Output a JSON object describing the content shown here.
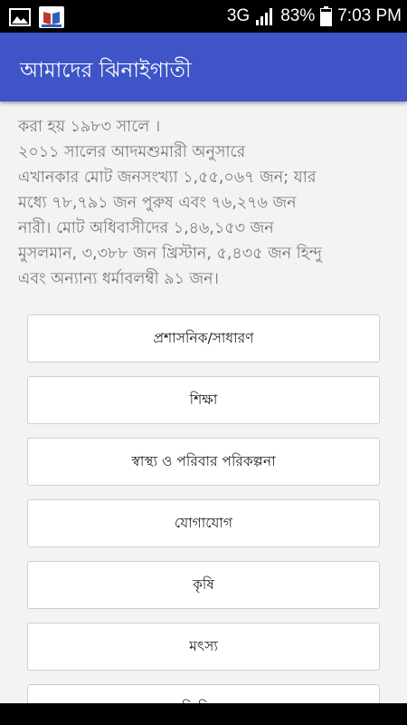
{
  "status_bar": {
    "network": "3G",
    "battery": "83%",
    "time": "7:03 PM",
    "icons": [
      "gallery-icon",
      "app-notification-icon",
      "signal-icon",
      "battery-icon"
    ]
  },
  "app_bar": {
    "title": "আমাদের ঝিনাইগাতী",
    "color": "#3f55c7"
  },
  "intro": {
    "lines": [
      "করা হয় ১৯৮৩ সালে ।",
      "২০১১ সালের আদমশুমারী অনুসারে",
      "এখানকার মোট জনসংখ্যা ১,৫৫,০৬৭ জন; যার",
      "মধ্যে ৭৮,৭৯১ জন পুরুষ এবং ৭৬,২৭৬ জন",
      "নারী। মোট অধিবাসীদের ১,৪৬,১৫৩ জন",
      "মুসলমান, ৩,৩৮৮ জন খ্রিস্টান, ৫,৪৩৫ জন হিন্দু",
      "এবং অন্যান্য ধর্মাবলম্বী ৯১ জন।"
    ]
  },
  "menu": {
    "items": [
      {
        "label": "প্রশাসনিক/সাধারণ"
      },
      {
        "label": "শিক্ষা"
      },
      {
        "label": "স্বাস্থ্য ও পরিবার পরিকল্পনা"
      },
      {
        "label": "যোগাযোগ"
      },
      {
        "label": "কৃষি"
      },
      {
        "label": "মৎস্য"
      },
      {
        "label": "ভূমি বিষয়ক"
      }
    ]
  }
}
